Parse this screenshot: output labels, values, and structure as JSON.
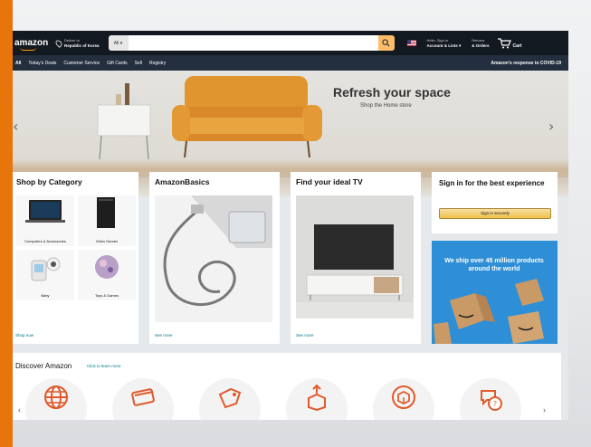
{
  "header": {
    "logo": "amazon",
    "deliver_line1": "Deliver to",
    "deliver_line2": "Republic of Korea",
    "search_category": "All ▾",
    "search_placeholder": "",
    "account_line1": "Hello, Sign in",
    "account_line2": "Account & Lists ▾",
    "orders_line1": "Returns",
    "orders_line2": "& Orders",
    "cart_label": "Cart"
  },
  "nav": {
    "items": [
      "All",
      "Today's Deals",
      "Customer Service",
      "Gift Cards",
      "Sell",
      "Registry"
    ],
    "covid": "Amazon's response to COVID-19"
  },
  "hero": {
    "title": "Refresh your space",
    "subtitle": "Shop the Home store"
  },
  "cards": {
    "category": {
      "title": "Shop by Category",
      "tiles": [
        "Computers & Accessories",
        "Video Games",
        "Baby",
        "Toys & Games"
      ],
      "link": "Shop now"
    },
    "basics": {
      "title": "AmazonBasics",
      "link": "See more"
    },
    "tv": {
      "title": "Find your ideal TV",
      "link": "See more"
    },
    "signin": {
      "title": "Sign in for the best experience",
      "button": "Sign in securely"
    },
    "ship": {
      "text": "We ship over 45 million products around the world"
    }
  },
  "discover": {
    "title": "Discover Amazon",
    "link": "Click to learn more",
    "icons": [
      "globe-icon",
      "payment-card-icon",
      "price-tag-icon",
      "box-upload-icon",
      "package-icon",
      "chat-question-icon"
    ]
  },
  "colors": {
    "accent": "#e8740c",
    "header_bg": "#131921",
    "subnav_bg": "#232f3e",
    "search_button": "#febd69",
    "icon_orange": "#e05a2b"
  }
}
